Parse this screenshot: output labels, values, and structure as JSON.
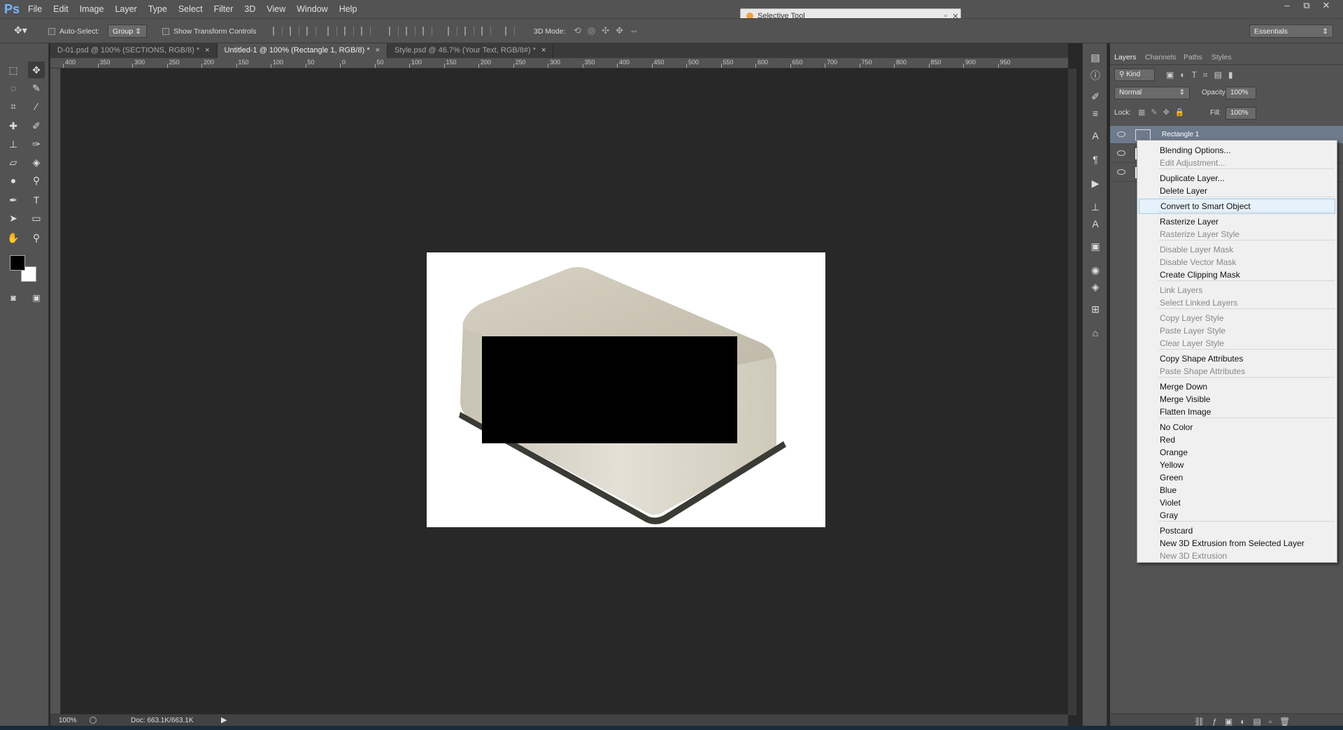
{
  "app": {
    "logo": "Ps"
  },
  "menubar": [
    "File",
    "Edit",
    "Image",
    "Layer",
    "Type",
    "Select",
    "Filter",
    "3D",
    "View",
    "Window",
    "Help"
  ],
  "window_controls": [
    "–",
    "⧉",
    "✕"
  ],
  "floating_dialog": {
    "title": "Selective Tool"
  },
  "options": {
    "auto_select_label": "Auto-Select:",
    "auto_select_value": "Group",
    "show_transform_label": "Show Transform Controls",
    "mode_label": "3D Mode:",
    "workspace": "Essentials"
  },
  "tabs": [
    {
      "label": "D-01.psd @ 100% (SECTIONS, RGB/8) *",
      "active": false
    },
    {
      "label": "Untitled-1 @ 100% (Rectangle 1, RGB/8) *",
      "active": true
    },
    {
      "label": "Style.psd @ 46.7% (Your Text, RGB/8#) *",
      "active": false
    }
  ],
  "ruler_h": [
    "400",
    "350",
    "300",
    "250",
    "200",
    "150",
    "100",
    "50",
    "0",
    "50",
    "100",
    "150",
    "200",
    "250",
    "300",
    "350",
    "400",
    "450",
    "500",
    "550",
    "600",
    "650",
    "700",
    "750",
    "800",
    "850",
    "900",
    "950"
  ],
  "status": {
    "zoom": "100%",
    "doc": "Doc: 663.1K/663.1K"
  },
  "panel": {
    "tabs": [
      "Layers",
      "Channels",
      "Paths",
      "Styles"
    ],
    "kind_filter": "Kind",
    "blend_mode": "Normal",
    "opacity_label": "Opacity:",
    "opacity_value": "100%",
    "lock_label": "Lock:",
    "fill_label": "Fill:",
    "fill_value": "100%",
    "layer_name": "Rectangle 1"
  },
  "context_menu": [
    {
      "label": "Blending Options...",
      "disabled": false
    },
    {
      "label": "Edit Adjustment...",
      "disabled": true
    },
    {
      "sep": true
    },
    {
      "label": "Duplicate Layer...",
      "disabled": false
    },
    {
      "label": "Delete Layer",
      "disabled": false
    },
    {
      "sep": true
    },
    {
      "label": "Convert to Smart Object",
      "disabled": false,
      "hover": true
    },
    {
      "sep": true
    },
    {
      "label": "Rasterize Layer",
      "disabled": false
    },
    {
      "label": "Rasterize Layer Style",
      "disabled": true
    },
    {
      "sep": true
    },
    {
      "label": "Disable Layer Mask",
      "disabled": true
    },
    {
      "label": "Disable Vector Mask",
      "disabled": true
    },
    {
      "label": "Create Clipping Mask",
      "disabled": false
    },
    {
      "sep": true
    },
    {
      "label": "Link Layers",
      "disabled": true
    },
    {
      "label": "Select Linked Layers",
      "disabled": true
    },
    {
      "sep": true
    },
    {
      "label": "Copy Layer Style",
      "disabled": true
    },
    {
      "label": "Paste Layer Style",
      "disabled": true
    },
    {
      "label": "Clear Layer Style",
      "disabled": true
    },
    {
      "sep": true
    },
    {
      "label": "Copy Shape Attributes",
      "disabled": false
    },
    {
      "label": "Paste Shape Attributes",
      "disabled": true
    },
    {
      "sep": true
    },
    {
      "label": "Merge Down",
      "disabled": false
    },
    {
      "label": "Merge Visible",
      "disabled": false
    },
    {
      "label": "Flatten Image",
      "disabled": false
    },
    {
      "sep": true
    },
    {
      "label": "No Color",
      "disabled": false
    },
    {
      "label": "Red",
      "disabled": false
    },
    {
      "label": "Orange",
      "disabled": false
    },
    {
      "label": "Yellow",
      "disabled": false
    },
    {
      "label": "Green",
      "disabled": false
    },
    {
      "label": "Blue",
      "disabled": false
    },
    {
      "label": "Violet",
      "disabled": false
    },
    {
      "label": "Gray",
      "disabled": false
    },
    {
      "sep": true
    },
    {
      "label": "Postcard",
      "disabled": false
    },
    {
      "label": "New 3D Extrusion from Selected Layer",
      "disabled": false
    },
    {
      "label": "New 3D Extrusion",
      "disabled": true
    }
  ]
}
